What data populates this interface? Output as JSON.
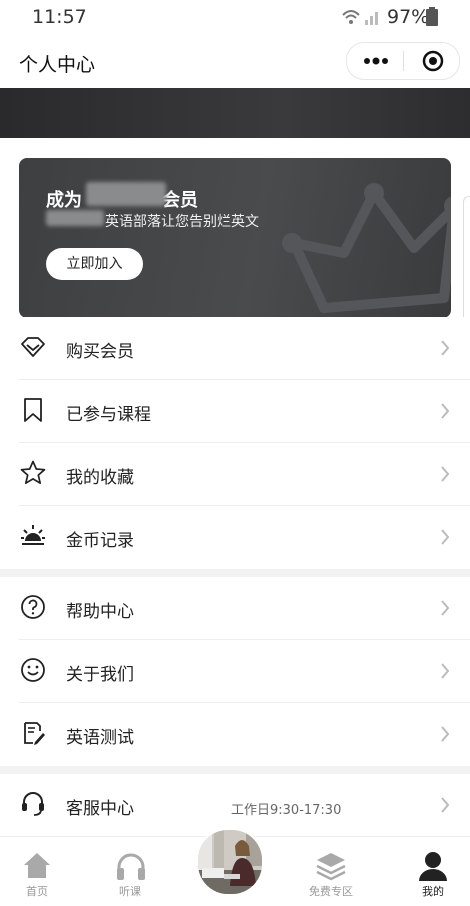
{
  "status": {
    "time": "11:57",
    "battery": "97%"
  },
  "navbar": {
    "title": "个人中心"
  },
  "membership": {
    "title_prefix": "成为",
    "title_suffix": "会员",
    "subtitle": "英语部落让您告别烂英文",
    "join_label": "立即加入"
  },
  "menu_group1": [
    {
      "label": "购买会员",
      "icon": "diamond-icon"
    },
    {
      "label": "已参与课程",
      "icon": "bookmark-icon"
    },
    {
      "label": "我的收藏",
      "icon": "star-icon"
    },
    {
      "label": "金币记录",
      "icon": "sun-icon"
    }
  ],
  "menu_group2": [
    {
      "label": "帮助中心",
      "icon": "question-icon"
    },
    {
      "label": "关于我们",
      "icon": "smile-icon"
    },
    {
      "label": "英语测试",
      "icon": "test-icon"
    }
  ],
  "service": {
    "label": "客服中心",
    "hours": "工作日9:30-17:30",
    "icon": "headset-icon"
  },
  "tabbar": {
    "tabs": [
      {
        "label": "首页",
        "icon": "home-icon"
      },
      {
        "label": "听课",
        "icon": "headphones-icon"
      },
      {
        "label": "免费专区",
        "icon": "layers-icon"
      },
      {
        "label": "我的",
        "icon": "person-icon"
      }
    ],
    "active": "我的"
  }
}
